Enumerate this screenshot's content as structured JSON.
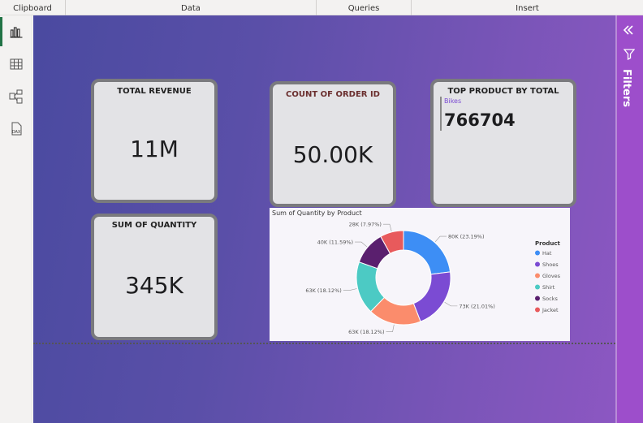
{
  "ribbon": {
    "groups": [
      "Clipboard",
      "Data",
      "Queries",
      "Insert"
    ]
  },
  "leftnav": {
    "items": [
      {
        "icon": "report-view-icon"
      },
      {
        "icon": "table-view-icon"
      },
      {
        "icon": "model-view-icon"
      },
      {
        "icon": "dax-query-view-icon",
        "label": "DAX"
      }
    ]
  },
  "cards": {
    "total_revenue": {
      "title": "TOTAL REVENUE",
      "value": "11M"
    },
    "count_order": {
      "title": "COUNT OF ORDER ID",
      "value": "50.00K"
    },
    "top_product": {
      "title": "TOP PRODUCT BY TOTAL",
      "category": "Bikes",
      "value": "766704"
    },
    "sum_quantity": {
      "title": "SUM OF QUANTITY",
      "value": "345K"
    }
  },
  "donut": {
    "title": "Sum of Quantity by Product",
    "legend_title": "Product"
  },
  "filters": {
    "label": "Filters"
  },
  "chart_data": {
    "type": "pie",
    "title": "Sum of Quantity by Product",
    "legend_title": "Product",
    "legend_position": "right",
    "categories": [
      "Hat",
      "Shoes",
      "Gloves",
      "Shirt",
      "Socks",
      "Jacket"
    ],
    "values": [
      80,
      73,
      63,
      63,
      40,
      28
    ],
    "labels": [
      "80K (23.19%)",
      "73K (21.01%)",
      "63K (18.12%)",
      "63K (18.12%)",
      "40K (11.59%)",
      "28K (7.97%)"
    ],
    "colors": [
      "#3d8ef5",
      "#7b4bd3",
      "#fb8c6c",
      "#4ccac4",
      "#5a1f6e",
      "#e85a5c"
    ]
  }
}
